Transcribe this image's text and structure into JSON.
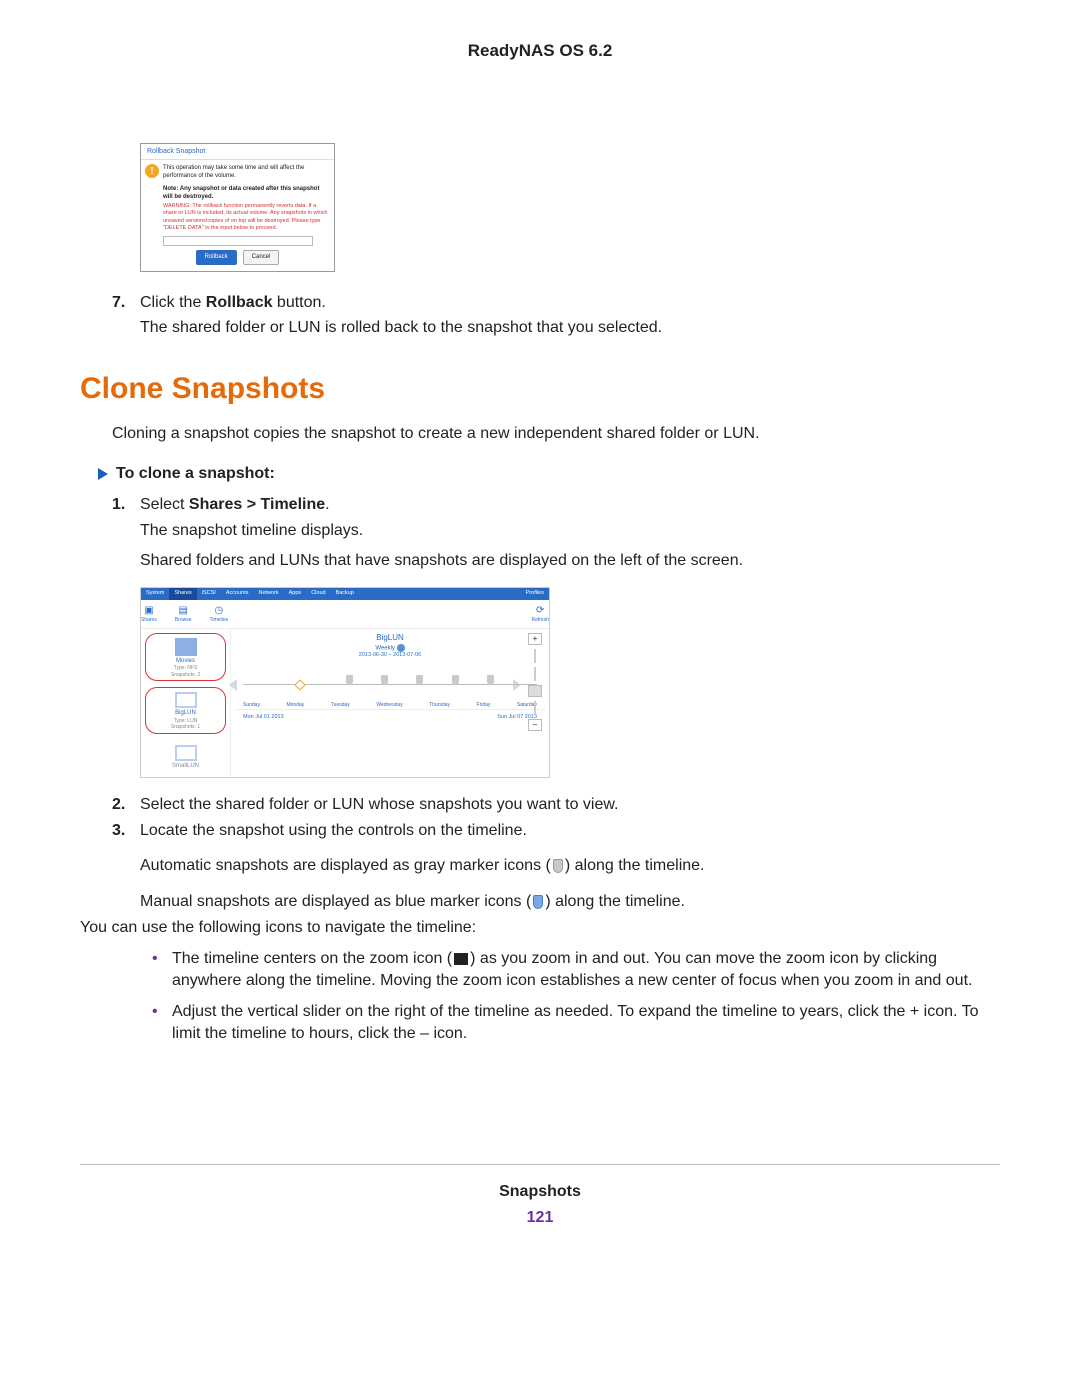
{
  "header": {
    "title": "ReadyNAS OS 6.2"
  },
  "dialog": {
    "title": "Rollback Snapshot",
    "line1": "This operation may take some time and will affect the performance of the volume.",
    "note": "Note: Any snapshot or data created after this snapshot will be destroyed.",
    "warning": "WARNING: The rollback function permanently reverts data. If a share or LUN is included, its actual volume. Any snapshots in which unsaved versions/copies of on top will be destroyed. Please type \"DELETE DATA\" in the input below to proceed.",
    "btn_primary": "Rollback",
    "btn_cancel": "Cancel"
  },
  "step7": {
    "num": "7.",
    "text_a": "Click the ",
    "bold": "Rollback",
    "text_b": " button.",
    "result": "The shared folder or LUN is rolled back to the snapshot that you selected."
  },
  "section_title": "Clone Snapshots",
  "intro": "Cloning a snapshot copies the snapshot to create a new independent shared folder or LUN.",
  "proc_title": "To clone a snapshot:",
  "steps": {
    "s1": {
      "num": "1.",
      "a": "Select ",
      "bold": "Shares > Timeline",
      "b": ".",
      "r1": "The snapshot timeline displays.",
      "r2": "Shared folders and LUNs that have snapshots are displayed on the left of the screen."
    },
    "s2": {
      "num": "2.",
      "text": "Select the shared folder or LUN whose snapshots you want to view."
    },
    "s3": {
      "num": "3.",
      "text": "Locate the snapshot using the controls on the timeline."
    }
  },
  "para_auto_a": "Automatic snapshots are displayed as gray marker icons (",
  "para_auto_b": ") along the timeline.",
  "para_man_a": "Manual snapshots are displayed as blue marker icons (",
  "para_man_b": ") along the timeline.",
  "nav_intro": "You can use the following icons to navigate the timeline:",
  "bullets": {
    "b1a": "The timeline centers on the zoom icon (",
    "b1b": ") as you zoom in and out. You can move the zoom icon by clicking anywhere along the timeline. Moving the zoom icon establishes a new center of focus when you zoom in and out.",
    "b2": "Adjust the vertical slider on the right of the timeline as needed. To expand the timeline to years, click the + icon. To limit the timeline to hours, click the – icon."
  },
  "timeline": {
    "tabs": [
      "System",
      "Shares",
      "iSCSI",
      "Accounts",
      "Network",
      "Apps",
      "Cloud",
      "Backup"
    ],
    "profiles": "Profiles",
    "iconbar": {
      "i1": "Shares",
      "i2": "Browse",
      "i3": "Timeline",
      "refresh": "Refresh"
    },
    "left": {
      "i1": {
        "name": "Movies",
        "type": "Type: NFS",
        "snap": "Snapshots: 2"
      },
      "i2": {
        "name": "BigLUN",
        "type": "Type: LUN",
        "snap": "Snapshots: 1"
      },
      "i3": {
        "name": "SmallLUN"
      }
    },
    "title": "BigLUN",
    "sub": "Weekly",
    "range": "2013-06-30 – 2013-07-06",
    "days": [
      "Sunday",
      "Monday",
      "Tuesday",
      "Wednesday",
      "Thursday",
      "Friday",
      "Saturday"
    ],
    "footer_l": "Mon Jul 01 2013",
    "footer_r": "Sun Jul 07 2013",
    "plus": "+",
    "minus": "–"
  },
  "footer": {
    "title": "Snapshots",
    "page": "121"
  }
}
